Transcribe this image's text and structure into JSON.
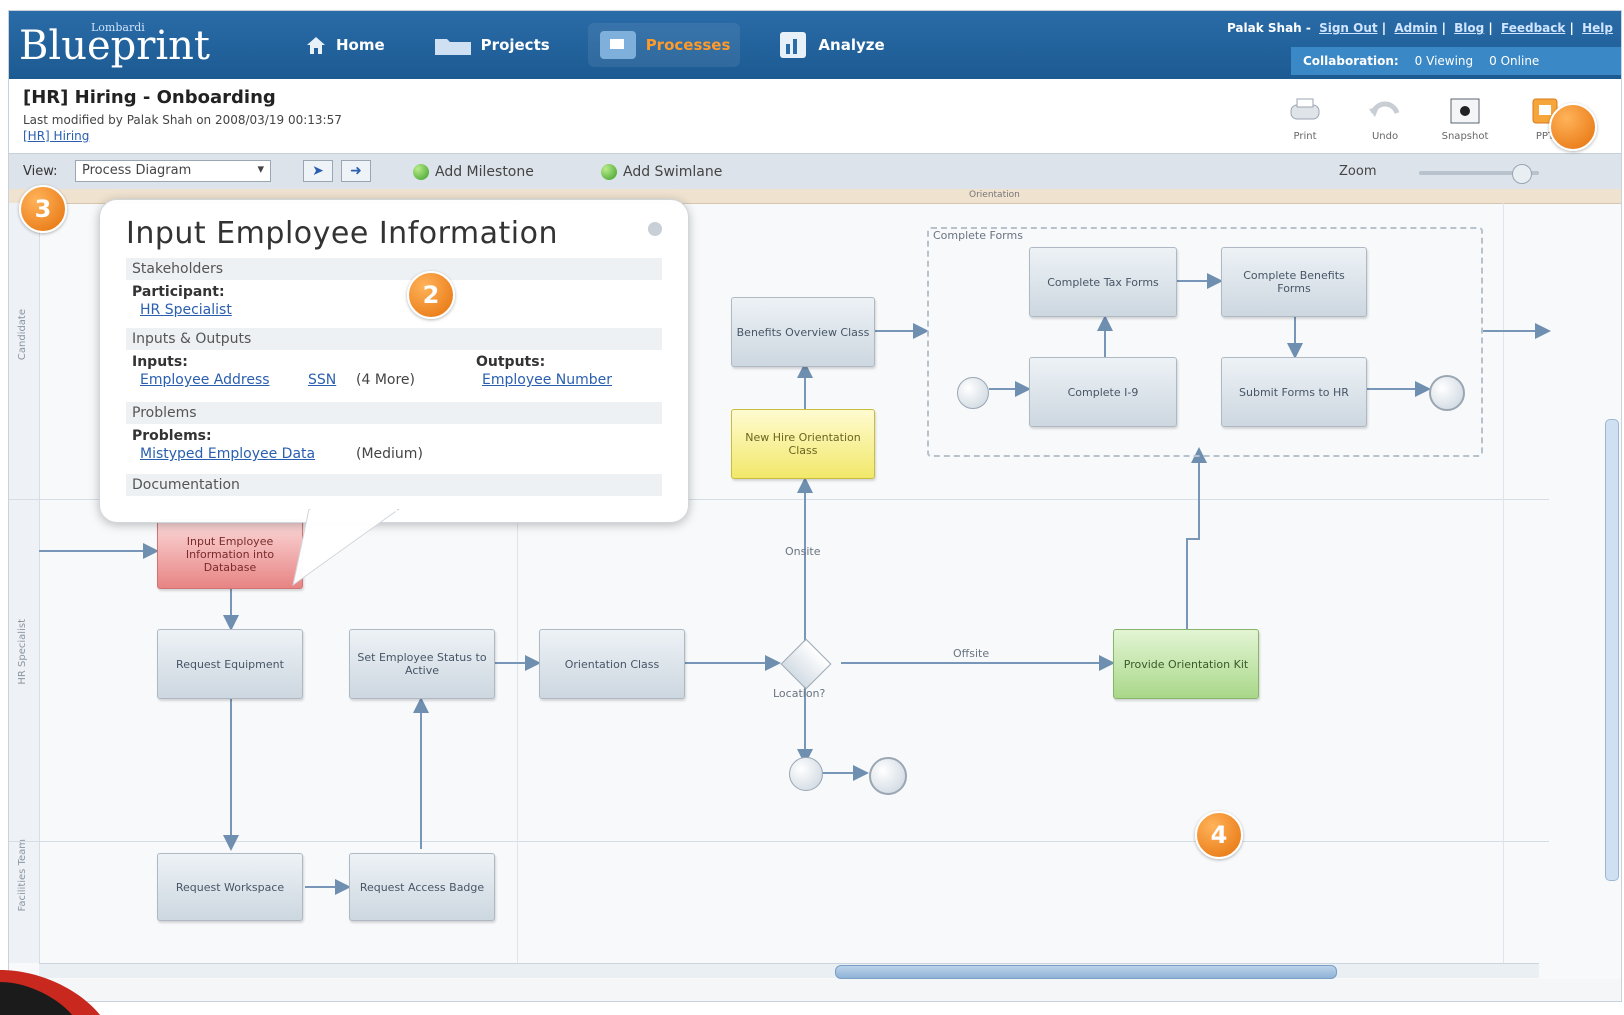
{
  "header": {
    "logo_sup": "Lombardi",
    "logo_text": "Blueprint",
    "nav": [
      {
        "label": "Home",
        "icon": "home-icon",
        "active": false
      },
      {
        "label": "Projects",
        "icon": "folder-icon",
        "active": false
      },
      {
        "label": "Processes",
        "icon": "process-icon",
        "active": true
      },
      {
        "label": "Analyze",
        "icon": "analyze-icon",
        "active": false
      }
    ],
    "user": "Palak Shah",
    "links": [
      "Sign Out",
      "Admin",
      "Blog",
      "Feedback",
      "Help"
    ],
    "collaboration_label": "Collaboration:",
    "viewing": "0 Viewing",
    "online": "0 Online"
  },
  "titlebar": {
    "title": "[HR] Hiring - Onboarding",
    "subtitle": "Last modified by Palak Shah on 2008/03/19 00:13:57",
    "link": "[HR] Hiring",
    "tools": [
      {
        "label": "Print",
        "icon": "print-icon"
      },
      {
        "label": "Undo",
        "icon": "undo-icon"
      },
      {
        "label": "Snapshot",
        "icon": "snapshot-icon"
      },
      {
        "label": "PPT",
        "icon": "ppt-icon"
      }
    ]
  },
  "toolbar": {
    "view_label": "View:",
    "view_value": "Process Diagram",
    "add_milestone": "Add Milestone",
    "add_swimlane": "Add Swimlane",
    "zoom_label": "Zoom",
    "zoom_level": 0.85
  },
  "canvas": {
    "milestone": "Orientation",
    "lanes": [
      "Candidate",
      "HR Specialist",
      "Facilities Team"
    ],
    "subprocess_label": "Complete Forms",
    "boxes": {
      "input_employee": "Input Employee Information into Database",
      "request_equipment": "Request Equipment",
      "set_status": "Set Employee Status to Active",
      "orientation_class": "Orientation Class",
      "benefits_overview": "Benefits Overview Class",
      "new_hire_orientation": "New Hire Orientation Class",
      "complete_tax": "Complete Tax Forms",
      "complete_benefits": "Complete Benefits Forms",
      "complete_i9": "Complete I-9",
      "submit_forms": "Submit Forms to HR",
      "provide_orientation": "Provide Orientation Kit",
      "request_workspace": "Request Workspace",
      "request_badge": "Request Access Badge"
    },
    "flow_labels": {
      "offsite": "Offsite",
      "onsite": "Onsite",
      "location": "Location?"
    }
  },
  "popup": {
    "title": "Input Employee Information",
    "stakeholders": "Stakeholders",
    "participant_label": "Participant:",
    "participant": "HR Specialist",
    "io_section": "Inputs & Outputs",
    "inputs_label": "Inputs:",
    "input1": "Employee Address",
    "input2": "SSN",
    "inputs_more": "(4 More)",
    "outputs_label": "Outputs:",
    "output1": "Employee Number",
    "problems_section": "Problems",
    "problems_label": "Problems:",
    "problem1": "Mistyped Employee Data",
    "problem_severity": "(Medium)",
    "documentation_section": "Documentation"
  },
  "badges": [
    "2",
    "3",
    "4"
  ],
  "colors": {
    "header_blue": "#1c5a92",
    "accent_orange": "#e5700a",
    "link_blue": "#2a5fb0"
  }
}
